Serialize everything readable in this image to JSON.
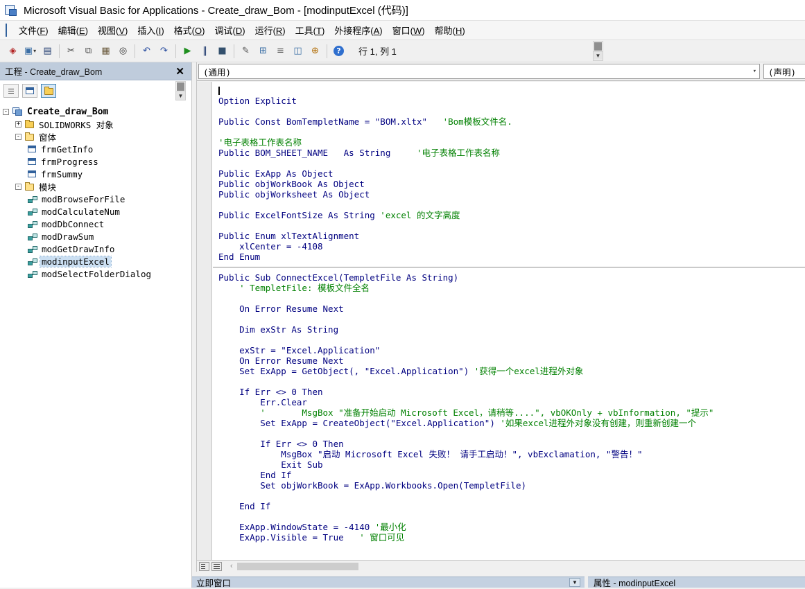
{
  "title_bar": {
    "title": "Microsoft Visual Basic for Applications - Create_draw_Bom - [modinputExcel (代码)]"
  },
  "menu": {
    "items": [
      {
        "text": "文件",
        "key": "F"
      },
      {
        "text": "编辑",
        "key": "E"
      },
      {
        "text": "视图",
        "key": "V"
      },
      {
        "text": "插入",
        "key": "I"
      },
      {
        "text": "格式",
        "key": "O"
      },
      {
        "text": "调试",
        "key": "D"
      },
      {
        "text": "运行",
        "key": "R"
      },
      {
        "text": "工具",
        "key": "T"
      },
      {
        "text": "外接程序",
        "key": "A"
      },
      {
        "text": "窗口",
        "key": "W"
      },
      {
        "text": "帮助",
        "key": "H"
      }
    ]
  },
  "toolbar": {
    "status": "行 1, 列 1",
    "buttons": [
      {
        "name": "host-app-icon",
        "glyph": "◈",
        "color": "#b22222"
      },
      {
        "name": "insert-userform-button",
        "glyph": "▣",
        "color": "#3a6ea5",
        "caret": true
      },
      {
        "name": "save-button",
        "glyph": "▤",
        "color": "#1f3a6e"
      },
      {
        "sep": true
      },
      {
        "name": "cut-button",
        "glyph": "✂",
        "color": "#444444"
      },
      {
        "name": "copy-button",
        "glyph": "⧉",
        "color": "#444444"
      },
      {
        "name": "paste-button",
        "glyph": "▦",
        "color": "#6b5b3e"
      },
      {
        "name": "find-button",
        "glyph": "◎",
        "color": "#333333"
      },
      {
        "sep": true
      },
      {
        "name": "undo-button",
        "glyph": "↶",
        "color": "#2b4fa0"
      },
      {
        "name": "redo-button",
        "glyph": "↷",
        "color": "#2b4fa0"
      },
      {
        "sep": true
      },
      {
        "name": "run-button",
        "glyph": "▶",
        "color": "#1e8f1e"
      },
      {
        "name": "pause-button",
        "glyph": "‖",
        "color": "#1f3a6e"
      },
      {
        "name": "stop-button",
        "glyph": "■",
        "color": "#33506d"
      },
      {
        "sep": true
      },
      {
        "name": "design-mode-button",
        "glyph": "✎",
        "color": "#555555"
      },
      {
        "name": "project-explorer-button",
        "glyph": "⊞",
        "color": "#3a6ea5"
      },
      {
        "name": "properties-window-button",
        "glyph": "≡",
        "color": "#555555"
      },
      {
        "name": "object-browser-button",
        "glyph": "◫",
        "color": "#3a6ea5"
      },
      {
        "name": "toolbox-button",
        "glyph": "⊕",
        "color": "#b06a00"
      },
      {
        "sep": true
      },
      {
        "name": "help-button",
        "glyph": "?",
        "color": "#ffffff",
        "circle": "#2f6fce"
      }
    ]
  },
  "project_panel": {
    "title": "工程 - Create_draw_Bom",
    "buttons": [
      {
        "name": "view-code-button",
        "icon": "code-lines",
        "active": false
      },
      {
        "name": "view-object-button",
        "icon": "form",
        "active": false
      },
      {
        "name": "toggle-folders-button",
        "icon": "folder",
        "active": true
      }
    ],
    "tree": [
      {
        "label": "Create_draw_Bom",
        "icon": "project",
        "depth": 0,
        "expand": "minus",
        "bold": true
      },
      {
        "label": "SOLIDWORKS 对象",
        "icon": "folder-closed",
        "depth": 1,
        "expand": "plus"
      },
      {
        "label": "窗体",
        "icon": "folder-open",
        "depth": 1,
        "expand": "minus"
      },
      {
        "label": "frmGetInfo",
        "icon": "form",
        "depth": 2
      },
      {
        "label": "frmProgress",
        "icon": "form",
        "depth": 2
      },
      {
        "label": "frmSummy",
        "icon": "form",
        "depth": 2
      },
      {
        "label": "模块",
        "icon": "folder-open",
        "depth": 1,
        "expand": "minus"
      },
      {
        "label": "modBrowseForFile",
        "icon": "module",
        "depth": 2
      },
      {
        "label": "modCalculateNum",
        "icon": "module",
        "depth": 2
      },
      {
        "label": "modDbConnect",
        "icon": "module",
        "depth": 2
      },
      {
        "label": "modDrawSum",
        "icon": "module",
        "depth": 2
      },
      {
        "label": "modGetDrawInfo",
        "icon": "module",
        "depth": 2
      },
      {
        "label": "modinputExcel",
        "icon": "module",
        "depth": 2,
        "selected": true
      },
      {
        "label": "modSelectFolderDialog",
        "icon": "module",
        "depth": 2
      }
    ]
  },
  "code_window": {
    "left_dropdown": "(通用)",
    "right_dropdown": "(声明)",
    "lines": [
      {
        "caret": true,
        "segments": []
      },
      {
        "segments": [
          {
            "t": "Option Explicit",
            "c": "code"
          }
        ]
      },
      {
        "segments": []
      },
      {
        "segments": [
          {
            "t": "Public Const BomTempletName = \"BOM.xltx\"   ",
            "c": "code"
          },
          {
            "t": "'Bom模板文件名.",
            "c": "comment"
          }
        ]
      },
      {
        "segments": []
      },
      {
        "segments": [
          {
            "t": "'电子表格工作表名称",
            "c": "comment"
          }
        ]
      },
      {
        "segments": [
          {
            "t": "Public BOM_SHEET_NAME   As String     ",
            "c": "code"
          },
          {
            "t": "'电子表格工作表名称",
            "c": "comment"
          }
        ]
      },
      {
        "segments": []
      },
      {
        "segments": [
          {
            "t": "Public ExApp As Object",
            "c": "code"
          }
        ]
      },
      {
        "segments": [
          {
            "t": "Public objWorkBook As Object",
            "c": "code"
          }
        ]
      },
      {
        "segments": [
          {
            "t": "Public objWorksheet As Object",
            "c": "code"
          }
        ]
      },
      {
        "segments": []
      },
      {
        "segments": [
          {
            "t": "Public ExcelFontSize As String ",
            "c": "code"
          },
          {
            "t": "'excel 的文字高度",
            "c": "comment"
          }
        ]
      },
      {
        "segments": []
      },
      {
        "segments": [
          {
            "t": "Public Enum xlTextAlignment",
            "c": "code"
          }
        ]
      },
      {
        "segments": [
          {
            "t": "    xlCenter = -4108",
            "c": "code"
          }
        ]
      },
      {
        "segments": [
          {
            "t": "End Enum",
            "c": "code"
          }
        ]
      },
      {
        "divider": true
      },
      {
        "segments": [
          {
            "t": "Public Sub ConnectExcel(TempletFile As String)",
            "c": "code"
          }
        ]
      },
      {
        "segments": [
          {
            "t": "    ",
            "c": "code"
          },
          {
            "t": "' TempletFile: 模板文件全名",
            "c": "comment"
          }
        ]
      },
      {
        "segments": []
      },
      {
        "segments": [
          {
            "t": "    On Error Resume Next",
            "c": "code"
          }
        ]
      },
      {
        "segments": []
      },
      {
        "segments": [
          {
            "t": "    Dim exStr As String",
            "c": "code"
          }
        ]
      },
      {
        "segments": []
      },
      {
        "segments": [
          {
            "t": "    exStr = \"Excel.Application\"",
            "c": "code"
          }
        ]
      },
      {
        "segments": [
          {
            "t": "    On Error Resume Next",
            "c": "code"
          }
        ]
      },
      {
        "segments": [
          {
            "t": "    Set ExApp = GetObject(, \"Excel.Application\") ",
            "c": "code"
          },
          {
            "t": "'获得一个excel进程外对象",
            "c": "comment"
          }
        ]
      },
      {
        "segments": []
      },
      {
        "segments": [
          {
            "t": "    If Err <> 0 Then",
            "c": "code"
          }
        ]
      },
      {
        "segments": [
          {
            "t": "        Err.Clear",
            "c": "code"
          }
        ]
      },
      {
        "segments": [
          {
            "t": "        '       MsgBox \"准备开始启动 Microsoft Excel，请稍等....\", vbOKOnly + vbInformation, \"提示\"",
            "c": "comment"
          }
        ]
      },
      {
        "segments": [
          {
            "t": "        Set ExApp = CreateObject(\"Excel.Application\") ",
            "c": "code"
          },
          {
            "t": "'如果excel进程外对象没有创建，则重新创建一个",
            "c": "comment"
          }
        ]
      },
      {
        "segments": []
      },
      {
        "segments": [
          {
            "t": "        If Err <> 0 Then",
            "c": "code"
          }
        ]
      },
      {
        "segments": [
          {
            "t": "            MsgBox \"启动 Microsoft Excel 失败！ 请手工启动！\", vbExclamation, \"警告！\"",
            "c": "code"
          }
        ]
      },
      {
        "segments": [
          {
            "t": "            Exit Sub",
            "c": "code"
          }
        ]
      },
      {
        "segments": [
          {
            "t": "        End If",
            "c": "code"
          }
        ]
      },
      {
        "segments": [
          {
            "t": "        Set objWorkBook = ExApp.Workbooks.Open(TempletFile)",
            "c": "code"
          }
        ]
      },
      {
        "segments": []
      },
      {
        "segments": [
          {
            "t": "    End If",
            "c": "code"
          }
        ]
      },
      {
        "segments": []
      },
      {
        "segments": [
          {
            "t": "    ExApp.WindowState = -4140 ",
            "c": "code"
          },
          {
            "t": "'最小化",
            "c": "comment"
          }
        ]
      },
      {
        "segments": [
          {
            "t": "    ExApp.Visible = True   ",
            "c": "code"
          },
          {
            "t": "' 窗口可见",
            "c": "comment"
          }
        ]
      }
    ]
  },
  "bottom": {
    "immediate_title": "立即窗口",
    "properties_title": "属性 - modinputExcel"
  }
}
